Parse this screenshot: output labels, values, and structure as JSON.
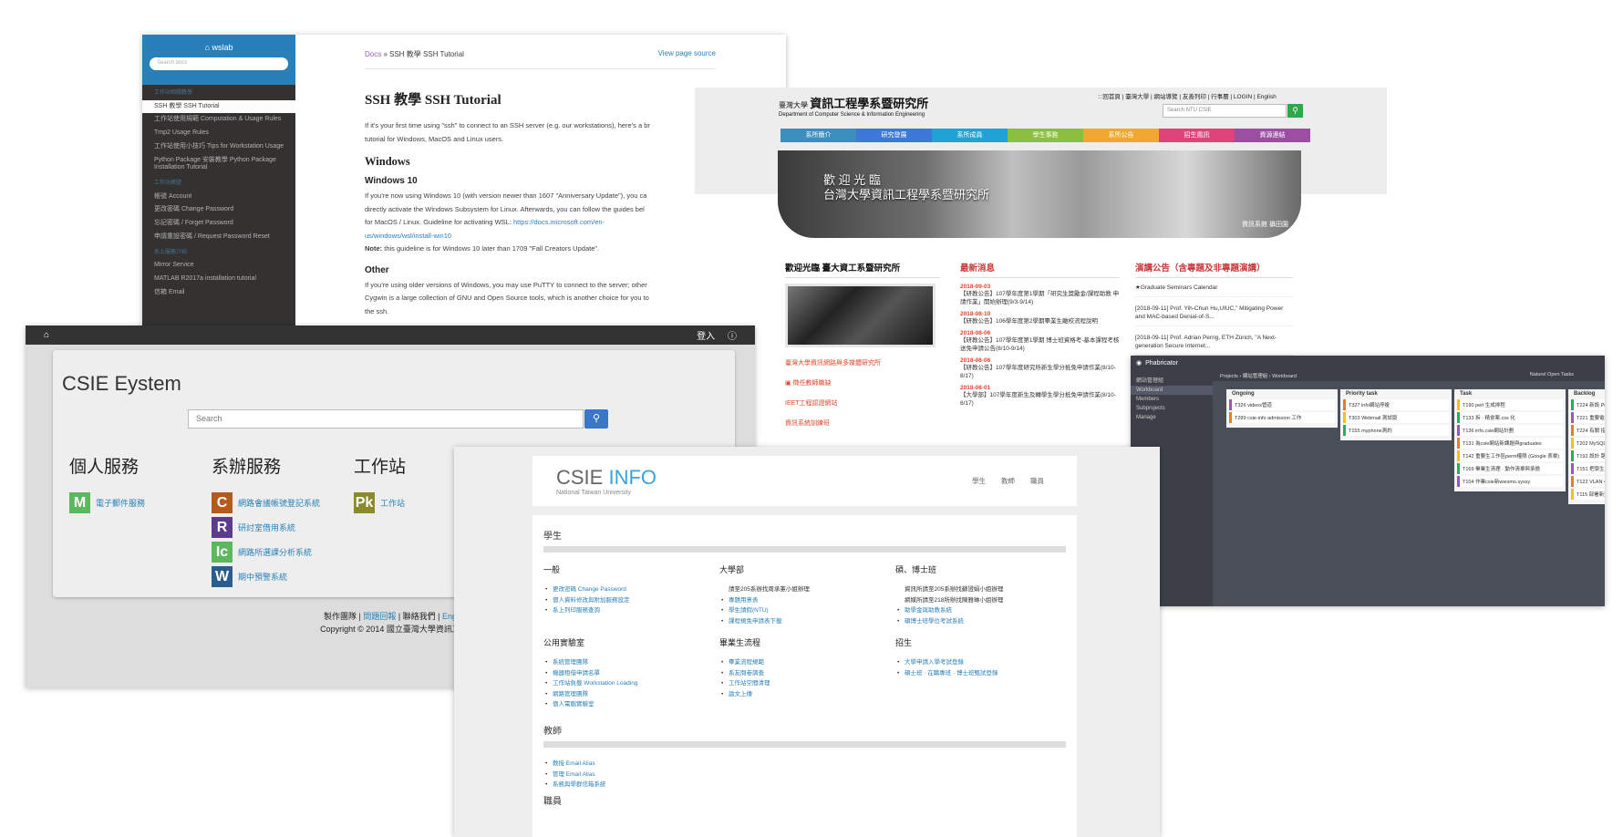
{
  "ssh_docs": {
    "brand": "⌂ wslab",
    "search_placeholder": "Search docs",
    "nav": [
      {
        "label": "工作站相關教學",
        "cap": true
      },
      {
        "label": "SSH 教學 SSH Tutorial",
        "current": true
      },
      {
        "label": "工作站使用規範 Computation & Usage Rules"
      },
      {
        "label": "Tmp2 Usage Rules"
      },
      {
        "label": "工作站使用小技巧 Tips for Workstation Usage"
      },
      {
        "label": "Python Package 安裝教學 Python Package Installation Tutorial"
      },
      {
        "label": "工作站帳號",
        "cap": true
      },
      {
        "label": "帳號 Account"
      },
      {
        "label": "更改密碼 Change Password"
      },
      {
        "label": "忘記密碼 / Forget Password"
      },
      {
        "label": "申請重設密碼 / Request Password Reset"
      },
      {
        "label": "系上服務介紹",
        "cap": true
      },
      {
        "label": "Mirror Service"
      },
      {
        "label": "MATLAB R2017a installation tutorial"
      },
      {
        "label": "信箱 Email"
      }
    ],
    "breadcrumb_docs": "Docs",
    "breadcrumb_rest": " » SSH 教學 SSH Tutorial",
    "view_source": "View page source",
    "title": "SSH 教學 SSH Tutorial",
    "intro_1": "If it's your first time using \"ssh\" to connect to an SSH server (e.g. our workstations), here's a br",
    "intro_2": "tutorial for Windows, MacOS and Linux users.",
    "h_windows": "Windows",
    "h_win10": "Windows 10",
    "w10_1": "If you're now using Windows 10 (with version newer than 1607 \"Anniversary Update\"), you ca",
    "w10_2": "directly activate the Windows Subsystem for Linux. Afterwards, you can follow the guides bel",
    "w10_3": "for MacOS / Linux. Guideline for activating WSL: ",
    "w10_link1": "https://docs.microsoft.com/en-",
    "w10_link2": "us/windows/wsl/install-win10",
    "note_label": "Note:",
    "note_text": " this guideline is for Windows 10 later than 1709 \"Fall Creators Update\".",
    "h_other": "Other",
    "other_1": "If you're using older versions of Windows, you may use PuTTY to connect to the server; other",
    "other_2": "Cygwin is a large collection of GNU and Open Source tools, which is another choice for you to",
    "other_3": "the ssh."
  },
  "eystem": {
    "home_icon": "home-icon",
    "login": "登入",
    "title": "CSIE Eystem",
    "search_placeholder": "Search",
    "columns": [
      {
        "title": "個人服務",
        "items": [
          {
            "badge": "M",
            "color": "#5cb85c",
            "label": "電子郵件服務"
          }
        ]
      },
      {
        "title": "系辦服務",
        "items": [
          {
            "badge": "C",
            "color": "#b35a1f",
            "label": "網路會議帳號登記系統"
          },
          {
            "badge": "R",
            "color": "#5b3b8c",
            "label": "研討室借用系統"
          },
          {
            "badge": "Ic",
            "color": "#5cb85c",
            "label": "網路所選課分析系統"
          },
          {
            "badge": "W",
            "color": "#2c5d8f",
            "label": "期中預警系統"
          }
        ]
      },
      {
        "title": "工作站",
        "items": [
          {
            "badge": "Pk",
            "color": "#8a8a2a",
            "label": "工作站"
          }
        ]
      }
    ],
    "footer_1a": "製作團隊 | ",
    "footer_1b": "問題回報",
    "footer_1c": " | 聯絡我們 | ",
    "footer_1d": "Eng",
    "footer_2": "Copyright © 2014 國立臺灣大學資訊工"
  },
  "ntu": {
    "logo_zh_small": "臺灣大學",
    "logo_zh": "資訊工程學系暨研究所",
    "logo_en": "Department of Computer Science & Information Engineering",
    "top_links": ":::回首頁 | 臺灣大學 | 網站導覽 | 友善列印 | 行事曆 | LOGIN | English",
    "search_placeholder": "Search NTU CSIE",
    "menu": [
      {
        "label": "系所簡介",
        "color": "#3b8fbf"
      },
      {
        "label": "研究發展",
        "color": "#3c78d8"
      },
      {
        "label": "系所成員",
        "color": "#1fa3d6"
      },
      {
        "label": "學生事務",
        "color": "#8cbf3f"
      },
      {
        "label": "系所公告",
        "color": "#f0a830"
      },
      {
        "label": "招生風訊",
        "color": "#e0427a"
      },
      {
        "label": "資源連結",
        "color": "#9b4fa0"
      }
    ],
    "banner_l1": "歡 迎 光 臨",
    "banner_l2": "台灣大學資訊工程學系暨研究所",
    "banner_cap": "資訊系館 攝田園",
    "welcome": "歡迎光臨 臺大資工系暨研究所",
    "links": [
      "臺灣大學資訊網路與多媒體研究所",
      "▣ 徵任教師職缺",
      "IEET工程認證網站",
      "資訊系統訓練班"
    ],
    "news_title": "最新消息",
    "news": [
      {
        "date": "2018-09-03",
        "text": "【研教公告】107學年度第1學期「研究生獎勵金/課程助教 申請作業」開始辦理(9/3-9/14)"
      },
      {
        "date": "2018-08-10",
        "text": "【研教公告】106學年度第2學期畢業生離校流程說明"
      },
      {
        "date": "2018-08-06",
        "text": "【研教公告】107學年度第1學期 博士班資格考-基本課程考核送免申請公告(8/10-9/14)"
      },
      {
        "date": "2018-08-06",
        "text": "【研教公告】107學年度研究所新生學分抵免申請作業(8/10-8/17)"
      },
      {
        "date": "2018-08-01",
        "text": "【大學部】107學年度新生及轉學生學分抵免申請作業(8/10-8/17)"
      }
    ],
    "talks_title": "演講公告（含專題及非專題演講）",
    "talks": [
      "★Graduate Seminars Calendar",
      "[2018-09-11] Prof. Yih-Chun Hu,UIUC,\" Mitigating Power and MAC-based Denial-of-S...",
      "[2018-09-11] Prof. Adrian Perrig, ETH Zürich, \"A Next-generation Secure Internet..."
    ]
  },
  "phab": {
    "brand": "Phabricator",
    "crumb": "Projects › 網站管理組 › Workboard",
    "tools": "Naturel  Open Tasks",
    "side": [
      "網站管理組",
      "Workboard",
      "Members",
      "Subprojects",
      "Manage"
    ],
    "columns": [
      {
        "title": "Ongoing",
        "cards": [
          "T326 videos管道",
          "T289 csie-info admission 工作"
        ]
      },
      {
        "title": "Priority task",
        "cards": [
          "T327 info網站停複",
          "T303 Webmail 測試版",
          "T155 myphone測約"
        ]
      },
      {
        "title": "Task",
        "cards": [
          "T190 perl 生成排程",
          "T133 拆 · 精會案.css 化",
          "T136 info.csie網站計劃",
          "T131 為csie網站新課題與graduates",
          "T142 重要生工作區perm權限 (Google 表單)",
          "T169 畢業生清理 · 動作清單與承擔",
          "T104 作業csie新wiesmo.syssy"
        ]
      },
      {
        "title": "Backlog",
        "cards": [
          "T224 新設 Prof",
          "T221 重要電話提",
          "T224 有關 指南",
          "T202 MySQL 重setlimit",
          "T192 設計 路管",
          "T151 把學生工作 Slack 上",
          "T122 VLAN 42 制",
          "T115 部署新型計"
        ]
      }
    ]
  },
  "info": {
    "logo_a": "CSIE ",
    "logo_b": "INFO",
    "sub": "National Taiwan University",
    "nav": [
      "學生",
      "教師",
      "職員"
    ],
    "sec_student": "學生",
    "groups1": [
      {
        "title": "一般",
        "items": [
          "更改密碼 Change Password",
          "個人資料修改與附加服務設定",
          "系上列印服務查詢"
        ]
      },
      {
        "title": "大學部",
        "items": [
          "請至205系辦找周承憲小姐辦理",
          "專題用意表",
          "學生請假(NTU)",
          "課程規免申請表下載"
        ],
        "plain_first": true
      },
      {
        "title": "碩、博士班",
        "items": [
          "資訊所請至205系辦找蘇證娟小姐辦理",
          "網媒所請至218所辦找陳雅琳小姐辦理",
          "助學金與助教系統",
          "碩博士班學位考試系統"
        ],
        "plain_count": 2
      }
    ],
    "groups2": [
      {
        "title": "公用實驗室",
        "items": [
          "系統管理團隊",
          "機器租借申請名單",
          "工作站負載 Workstation Loading",
          "網路管理團隊",
          "個人電腦實驗室"
        ]
      },
      {
        "title": "畢業生流程",
        "items": [
          "畢業流程規範",
          "系友問卷調查",
          "工作站空間清理",
          "論文上傳"
        ]
      },
      {
        "title": "招生",
        "items": [
          "大學申請入學考試登錄",
          "碩士班 · 在職專班 · 博士班甄試登錄"
        ]
      }
    ],
    "sec_teacher": "教師",
    "teacher_items": [
      "教授 Email Alias",
      "管理 Email Alias",
      "系務與學群信箱系統"
    ],
    "sec_staff": "職員"
  }
}
